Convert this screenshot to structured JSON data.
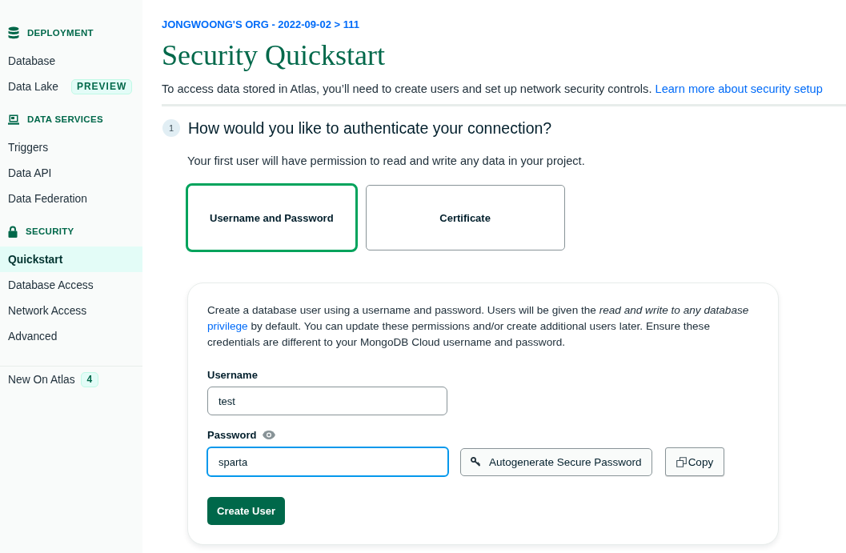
{
  "sidebar": {
    "sections": [
      {
        "title": "DEPLOYMENT",
        "items": [
          {
            "label": "Database",
            "selected": false
          },
          {
            "label": "Data Lake",
            "badge": "PREVIEW",
            "selected": false
          }
        ]
      },
      {
        "title": "DATA SERVICES",
        "items": [
          {
            "label": "Triggers",
            "selected": false
          },
          {
            "label": "Data API",
            "selected": false
          },
          {
            "label": "Data Federation",
            "selected": false
          }
        ]
      },
      {
        "title": "SECURITY",
        "items": [
          {
            "label": "Quickstart",
            "selected": true
          },
          {
            "label": "Database Access",
            "selected": false
          },
          {
            "label": "Network Access",
            "selected": false
          },
          {
            "label": "Advanced",
            "selected": false
          }
        ]
      }
    ],
    "footer_item": {
      "label": "New On Atlas",
      "badge": "4"
    }
  },
  "breadcrumb": "JONGWOONG'S ORG - 2022-09-02 > 111",
  "title": "Security Quickstart",
  "intro": {
    "text": "To access data stored in Atlas, you’ll need to create users and set up network security controls.",
    "link": "Learn more about security setup"
  },
  "step": {
    "number": "1",
    "question": "How would you like to authenticate your connection?",
    "description": "Your first user will have permission to read and write any data in your project."
  },
  "auth_options": [
    {
      "label": "Username and Password",
      "selected": true
    },
    {
      "label": "Certificate",
      "selected": false
    }
  ],
  "user_form": {
    "description": {
      "before": "Create a database user using a username and password. Users will be given the *read and write to any database*",
      "link": "privilege",
      "after": "by default. You can update these permissions and/or create additional users later. Ensure these credentials are different to your MongoDB Cloud username and password."
    },
    "fields": [
      {
        "kind": "text",
        "label": "Username",
        "value": "test",
        "focused": false
      },
      {
        "kind": "password",
        "label": "Password",
        "value": "sparta",
        "focused": true
      }
    ],
    "autogenerate_button": "Autogenerate Secure Password",
    "copy_button": "Copy",
    "submit_button": "Create User"
  }
}
